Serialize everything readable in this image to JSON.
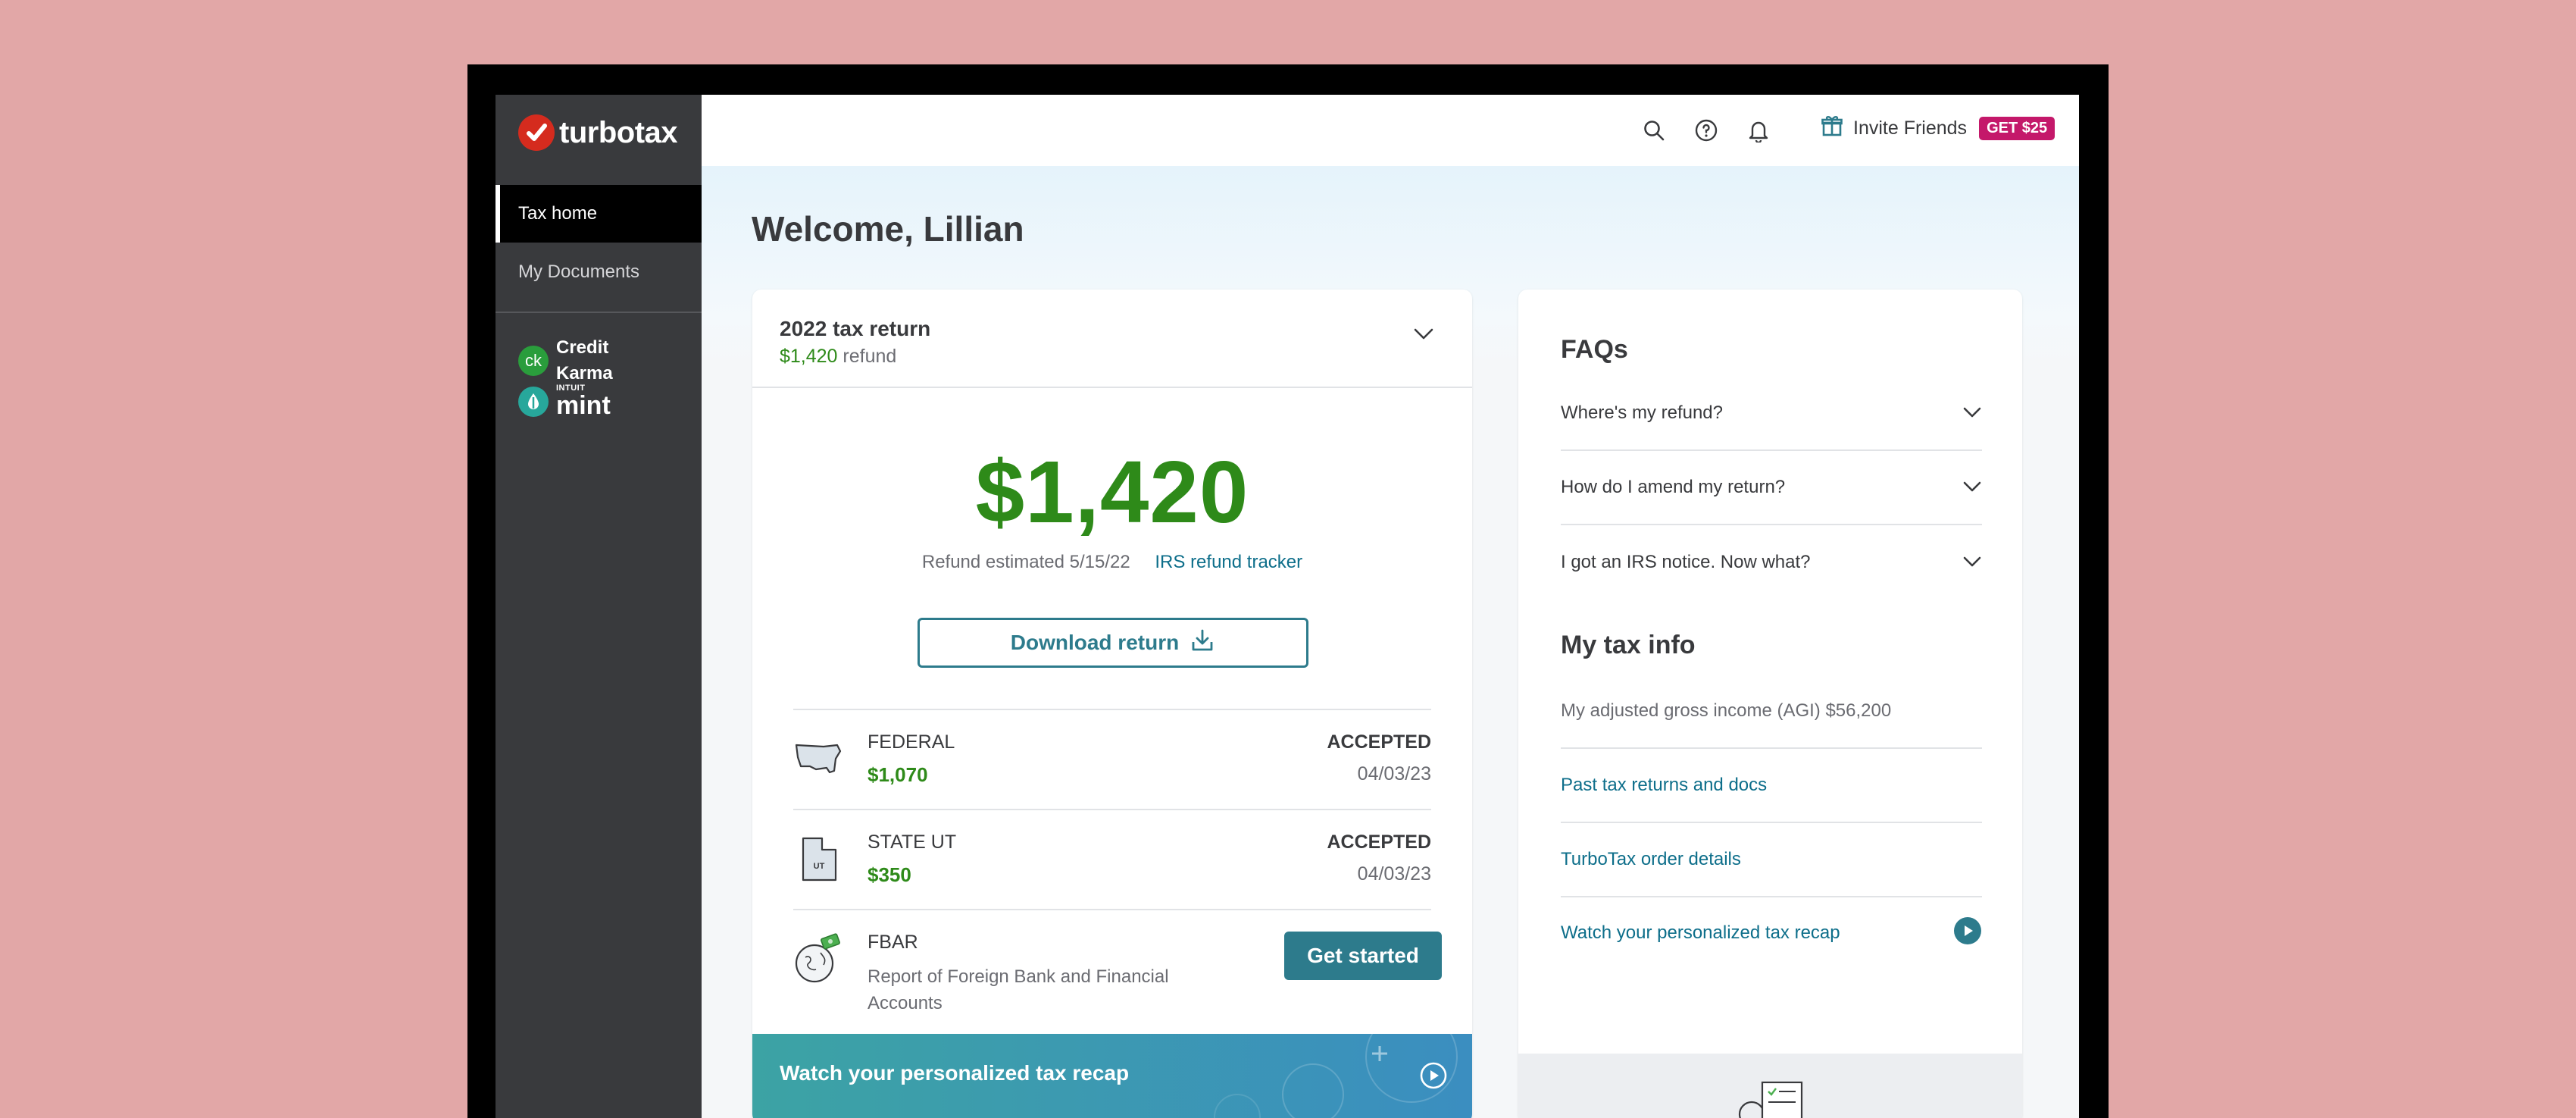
{
  "brand": {
    "logo_text": "turbotax"
  },
  "sidebar": {
    "items": [
      {
        "label": "Tax home"
      },
      {
        "label": "My Documents"
      }
    ],
    "partners": {
      "credit_karma_line1": "Credit",
      "credit_karma_line2": "Karma",
      "ck_short": "ck",
      "intuit": "INTUIT",
      "mint": "mint"
    }
  },
  "header": {
    "invite_label": "Invite Friends",
    "invite_badge": "GET $25"
  },
  "main": {
    "welcome": "Welcome, Lillian",
    "return_card": {
      "title": "2022 tax return",
      "refund_amount_small": "$1,420",
      "refund_suffix": "refund",
      "big_amount": "$1,420",
      "estimate_text": "Refund estimated 5/15/22",
      "tracker_link": "IRS refund tracker",
      "download_label": "Download return",
      "rows": [
        {
          "name": "FEDERAL",
          "amount": "$1,070",
          "status": "ACCEPTED",
          "date": "04/03/23"
        },
        {
          "name": "STATE UT",
          "amount": "$350",
          "status": "ACCEPTED",
          "date": "04/03/23",
          "icon_text": "UT"
        },
        {
          "name": "FBAR",
          "description": "Report of Foreign Bank and Financial Accounts",
          "action": "Get started"
        }
      ],
      "recap_banner": "Watch your personalized tax recap"
    },
    "faqs": {
      "title": "FAQs",
      "items": [
        "Where's my refund?",
        "How do I amend my return?",
        "I got an IRS notice. Now what?"
      ]
    },
    "tax_info": {
      "title": "My tax info",
      "agi": "My adjusted gross income (AGI) $56,200",
      "links": [
        "Past tax returns and docs",
        "TurboTax order details",
        "Watch your personalized tax recap"
      ]
    }
  },
  "colors": {
    "accent": "#2d7b8c",
    "positive": "#2e8a19",
    "brand_red": "#d52b1e",
    "badge": "#c4186a",
    "sidebar": "#393a3d"
  }
}
